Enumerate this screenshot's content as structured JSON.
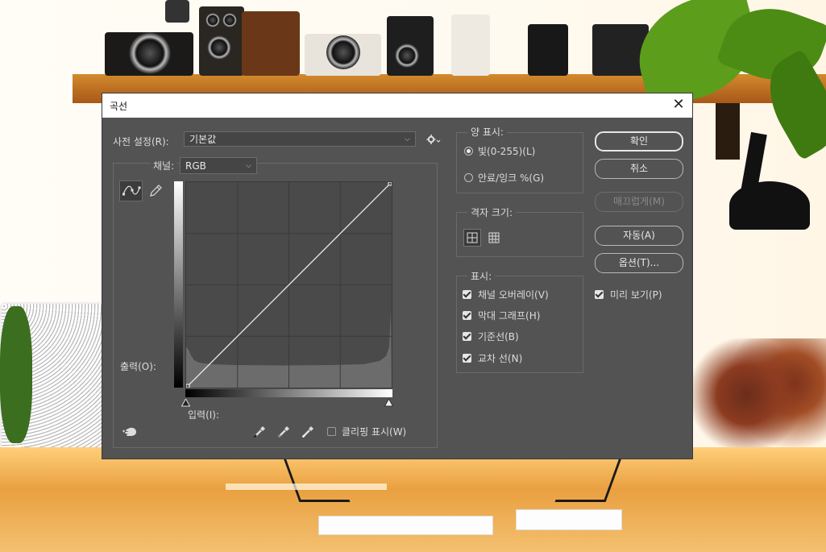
{
  "dialog": {
    "title": "곡선",
    "close": "✕"
  },
  "preset": {
    "label": "사전 설정(R):",
    "value": "기본값"
  },
  "channel": {
    "label": "채널:",
    "value": "RGB"
  },
  "axes": {
    "output_label": "출력(O):",
    "input_label": "입력(I):"
  },
  "clipping": {
    "label": "클리핑 표시(W)",
    "checked": false
  },
  "amount": {
    "legend": "양 표시:",
    "options": [
      {
        "label": "빛(0-255)(L)",
        "selected": true
      },
      {
        "label": "안료/잉크 %(G)",
        "selected": false
      }
    ]
  },
  "grid_size": {
    "legend": "격자 크기:"
  },
  "show": {
    "legend": "표시:",
    "options": [
      {
        "label": "채널 오버레이(V)",
        "checked": true
      },
      {
        "label": "막대 그래프(H)",
        "checked": true
      },
      {
        "label": "기준선(B)",
        "checked": true
      },
      {
        "label": "교차 선(N)",
        "checked": true
      }
    ]
  },
  "buttons": {
    "ok": "확인",
    "cancel": "취소",
    "smooth": "매끄럽게(M)",
    "auto": "자동(A)",
    "options": "옵션(T)..."
  },
  "preview": {
    "label": "미리 보기(P)",
    "checked": true
  },
  "icons": {
    "curve_tool": "curve-point-icon",
    "pencil_tool": "pencil-icon",
    "gear": "gear-icon",
    "on_image": "hand-adjust-icon",
    "eyedroppers": [
      "black-eyedropper-icon",
      "gray-eyedropper-icon",
      "white-eyedropper-icon"
    ]
  },
  "colors": {
    "panel": "#535353",
    "graph": "#4a4a4a",
    "grid": "#3b3b3b",
    "histogram": "#6e6e6e"
  }
}
